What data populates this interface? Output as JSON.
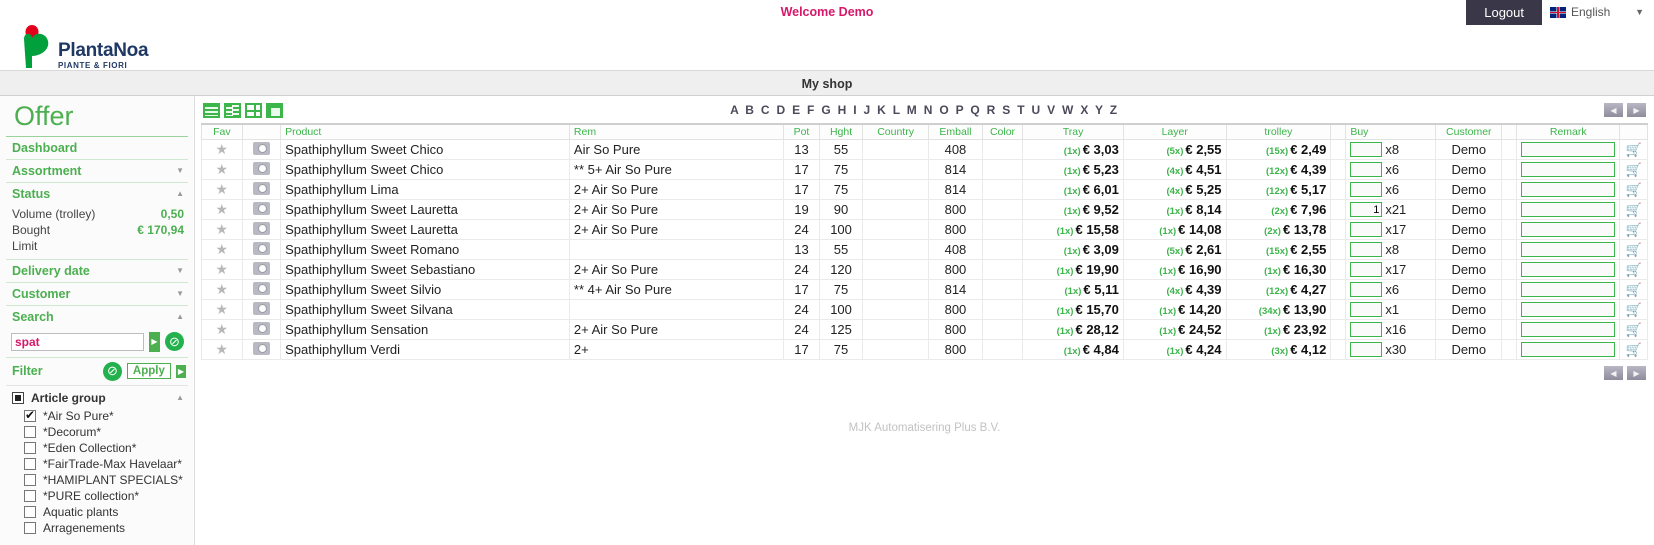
{
  "topbar": {
    "welcome": "Welcome Demo",
    "logout_label": "Logout",
    "language": "English",
    "flag_icon": "uk-flag-icon",
    "caret_icon": "▼"
  },
  "logo": {
    "name": "PlantaNoa",
    "tagline": "PIANTE & FIORI"
  },
  "shopbar": {
    "title": "My shop"
  },
  "sidebar": {
    "title": "Offer",
    "nav": [
      {
        "label": "Dashboard",
        "caret": ""
      },
      {
        "label": "Assortment",
        "caret": "▼"
      }
    ],
    "status": {
      "label": "Status",
      "caret": "▲",
      "rows": [
        {
          "label": "Volume (trolley)",
          "value": "0,50"
        },
        {
          "label": "Bought",
          "value": "€ 170,94"
        },
        {
          "label": "Limit",
          "value": ""
        }
      ]
    },
    "delivery": {
      "label": "Delivery date",
      "caret": "▼"
    },
    "customer": {
      "label": "Customer",
      "caret": "▼"
    },
    "search": {
      "label": "Search",
      "caret": "▲",
      "value": "spat",
      "placeholder": "",
      "go_icon": "▶",
      "clear_icon": "⊘"
    },
    "filter": {
      "label": "Filter",
      "clear_icon": "⊘",
      "apply_label": "Apply",
      "apply_arrow": "▶",
      "group_title": "Article group",
      "group_caret": "▲",
      "items": [
        {
          "label": "*Air So Pure*",
          "checked": true
        },
        {
          "label": "*Decorum*",
          "checked": false
        },
        {
          "label": "*Eden Collection*",
          "checked": false
        },
        {
          "label": "*FairTrade-Max Havelaar*",
          "checked": false
        },
        {
          "label": "*HAMIPLANT SPECIALS*",
          "checked": false
        },
        {
          "label": "*PURE collection*",
          "checked": false
        },
        {
          "label": "Aquatic plants",
          "checked": false
        },
        {
          "label": "Arragenements",
          "checked": false
        }
      ]
    }
  },
  "toolbar": {
    "view_icons": [
      "list-view-icon",
      "split-view-icon",
      "grid-view-icon",
      "tile-view-icon"
    ],
    "alphabet": [
      "A",
      "B",
      "C",
      "D",
      "E",
      "F",
      "G",
      "H",
      "I",
      "J",
      "K",
      "L",
      "M",
      "N",
      "O",
      "P",
      "Q",
      "R",
      "S",
      "T",
      "U",
      "V",
      "W",
      "X",
      "Y",
      "Z"
    ],
    "prev_icon": "◀",
    "next_icon": "▶"
  },
  "table": {
    "headers": {
      "fav": "Fav",
      "photo": "",
      "product": "Product",
      "rem": "Rem",
      "pot": "Pot",
      "hght": "Hght",
      "country": "Country",
      "emball": "Emball",
      "color": "Color",
      "tray": "Tray",
      "layer": "Layer",
      "trolley": "trolley",
      "spacer": "",
      "buy": "Buy",
      "customer": "Customer",
      "spacer2": "",
      "remark": "Remark",
      "cart": ""
    },
    "rows": [
      {
        "fav": "★",
        "photo": "camera-icon",
        "product": "Spathiphyllum Sweet Chico",
        "rem": "Air So Pure",
        "pot": "13",
        "hght": "55",
        "country": "",
        "emball": "408",
        "color": "",
        "tray_mult": "(1x)",
        "tray_price": "€ 3,03",
        "layer_mult": "(5x)",
        "layer_price": "€ 2,55",
        "trolley_mult": "(15x)",
        "trolley_price": "€ 2,49",
        "buy_value": "",
        "buy_x": "x8",
        "customer": "Demo",
        "remark": "",
        "cart_active": false
      },
      {
        "fav": "★",
        "photo": "camera-icon",
        "product": "Spathiphyllum Sweet Chico",
        "rem": "** 5+ Air So Pure",
        "pot": "17",
        "hght": "75",
        "country": "",
        "emball": "814",
        "color": "",
        "tray_mult": "(1x)",
        "tray_price": "€ 5,23",
        "layer_mult": "(4x)",
        "layer_price": "€ 4,51",
        "trolley_mult": "(12x)",
        "trolley_price": "€ 4,39",
        "buy_value": "",
        "buy_x": "x6",
        "customer": "Demo",
        "remark": "",
        "cart_active": false
      },
      {
        "fav": "★",
        "photo": "camera-icon",
        "product": "Spathiphyllum Lima",
        "rem": "2+ Air So Pure",
        "pot": "17",
        "hght": "75",
        "country": "",
        "emball": "814",
        "color": "",
        "tray_mult": "(1x)",
        "tray_price": "€ 6,01",
        "layer_mult": "(4x)",
        "layer_price": "€ 5,25",
        "trolley_mult": "(12x)",
        "trolley_price": "€ 5,17",
        "buy_value": "",
        "buy_x": "x6",
        "customer": "Demo",
        "remark": "",
        "cart_active": false
      },
      {
        "fav": "★",
        "photo": "camera-icon",
        "product": "Spathiphyllum Sweet Lauretta",
        "rem": "2+ Air So Pure",
        "pot": "19",
        "hght": "90",
        "country": "",
        "emball": "800",
        "color": "",
        "tray_mult": "(1x)",
        "tray_price": "€ 9,52",
        "layer_mult": "(1x)",
        "layer_price": "€ 8,14",
        "trolley_mult": "(2x)",
        "trolley_price": "€ 7,96",
        "buy_value": "1",
        "buy_x": "x21",
        "customer": "Demo",
        "remark": "",
        "cart_active": true
      },
      {
        "fav": "★",
        "photo": "camera-icon",
        "product": "Spathiphyllum Sweet Lauretta",
        "rem": "2+ Air So Pure",
        "pot": "24",
        "hght": "100",
        "country": "",
        "emball": "800",
        "color": "",
        "tray_mult": "(1x)",
        "tray_price": "€ 15,58",
        "layer_mult": "(1x)",
        "layer_price": "€ 14,08",
        "trolley_mult": "(2x)",
        "trolley_price": "€ 13,78",
        "buy_value": "",
        "buy_x": "x17",
        "customer": "Demo",
        "remark": "",
        "cart_active": false
      },
      {
        "fav": "★",
        "photo": "camera-icon",
        "product": "Spathiphyllum Sweet Romano",
        "rem": "",
        "pot": "13",
        "hght": "55",
        "country": "",
        "emball": "408",
        "color": "",
        "tray_mult": "(1x)",
        "tray_price": "€ 3,09",
        "layer_mult": "(5x)",
        "layer_price": "€ 2,61",
        "trolley_mult": "(15x)",
        "trolley_price": "€ 2,55",
        "buy_value": "",
        "buy_x": "x8",
        "customer": "Demo",
        "remark": "",
        "cart_active": false
      },
      {
        "fav": "★",
        "photo": "camera-icon",
        "product": "Spathiphyllum Sweet Sebastiano",
        "rem": "2+ Air So Pure",
        "pot": "24",
        "hght": "120",
        "country": "",
        "emball": "800",
        "color": "",
        "tray_mult": "(1x)",
        "tray_price": "€ 19,90",
        "layer_mult": "(1x)",
        "layer_price": "€ 16,90",
        "trolley_mult": "(1x)",
        "trolley_price": "€ 16,30",
        "buy_value": "",
        "buy_x": "x17",
        "customer": "Demo",
        "remark": "",
        "cart_active": false
      },
      {
        "fav": "★",
        "photo": "camera-icon",
        "product": "Spathiphyllum Sweet Silvio",
        "rem": "** 4+ Air So Pure",
        "pot": "17",
        "hght": "75",
        "country": "",
        "emball": "814",
        "color": "",
        "tray_mult": "(1x)",
        "tray_price": "€ 5,11",
        "layer_mult": "(4x)",
        "layer_price": "€ 4,39",
        "trolley_mult": "(12x)",
        "trolley_price": "€ 4,27",
        "buy_value": "",
        "buy_x": "x6",
        "customer": "Demo",
        "remark": "",
        "cart_active": false
      },
      {
        "fav": "★",
        "photo": "camera-icon",
        "product": "Spathiphyllum Sweet Silvana",
        "rem": "",
        "pot": "24",
        "hght": "100",
        "country": "",
        "emball": "800",
        "color": "",
        "tray_mult": "(1x)",
        "tray_price": "€ 15,70",
        "layer_mult": "(1x)",
        "layer_price": "€ 14,20",
        "trolley_mult": "(34x)",
        "trolley_price": "€ 13,90",
        "buy_value": "",
        "buy_x": "x1",
        "customer": "Demo",
        "remark": "",
        "cart_active": false
      },
      {
        "fav": "★",
        "photo": "camera-icon",
        "product": "Spathiphyllum Sensation",
        "rem": "2+ Air So Pure",
        "pot": "24",
        "hght": "125",
        "country": "",
        "emball": "800",
        "color": "",
        "tray_mult": "(1x)",
        "tray_price": "€ 28,12",
        "layer_mult": "(1x)",
        "layer_price": "€ 24,52",
        "trolley_mult": "(1x)",
        "trolley_price": "€ 23,92",
        "buy_value": "",
        "buy_x": "x16",
        "customer": "Demo",
        "remark": "",
        "cart_active": false
      },
      {
        "fav": "★",
        "photo": "camera-icon",
        "product": "Spathiphyllum Verdi",
        "rem": "2+",
        "pot": "17",
        "hght": "75",
        "country": "",
        "emball": "800",
        "color": "",
        "tray_mult": "(1x)",
        "tray_price": "€ 4,84",
        "layer_mult": "(1x)",
        "layer_price": "€ 4,24",
        "trolley_mult": "(3x)",
        "trolley_price": "€ 4,12",
        "buy_value": "",
        "buy_x": "x30",
        "customer": "Demo",
        "remark": "",
        "cart_active": false
      }
    ]
  },
  "footer": {
    "text": "MJK Automatisering Plus B.V."
  },
  "colors": {
    "accent_green": "#3cb54a",
    "brand_blue": "#1f3864",
    "welcome_pink": "#d6186a",
    "topbar_dark": "#2f2c3d"
  }
}
